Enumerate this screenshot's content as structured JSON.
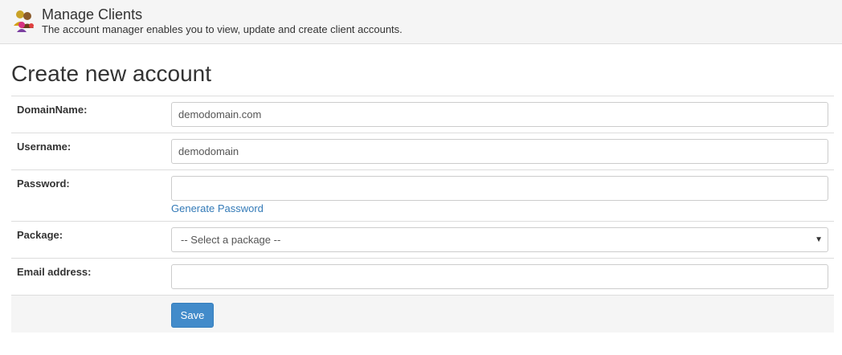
{
  "header": {
    "title": "Manage Clients",
    "subtitle": "The account manager enables you to view, update and create client accounts.",
    "icon": "users-icon"
  },
  "page": {
    "title": "Create new account"
  },
  "form": {
    "domain": {
      "label": "DomainName:",
      "value": "demodomain.com"
    },
    "username": {
      "label": "Username:",
      "value": "demodomain"
    },
    "password": {
      "label": "Password:",
      "value": "",
      "generate_link": "Generate Password"
    },
    "package": {
      "label": "Package:",
      "selected": "-- Select a package --"
    },
    "email": {
      "label": "Email address:",
      "value": ""
    },
    "save_label": "Save"
  },
  "colors": {
    "header_bg": "#f5f5f5",
    "footer_row_bg": "#f5f5f5",
    "link": "#337ab7",
    "primary_button": "#428bca"
  }
}
